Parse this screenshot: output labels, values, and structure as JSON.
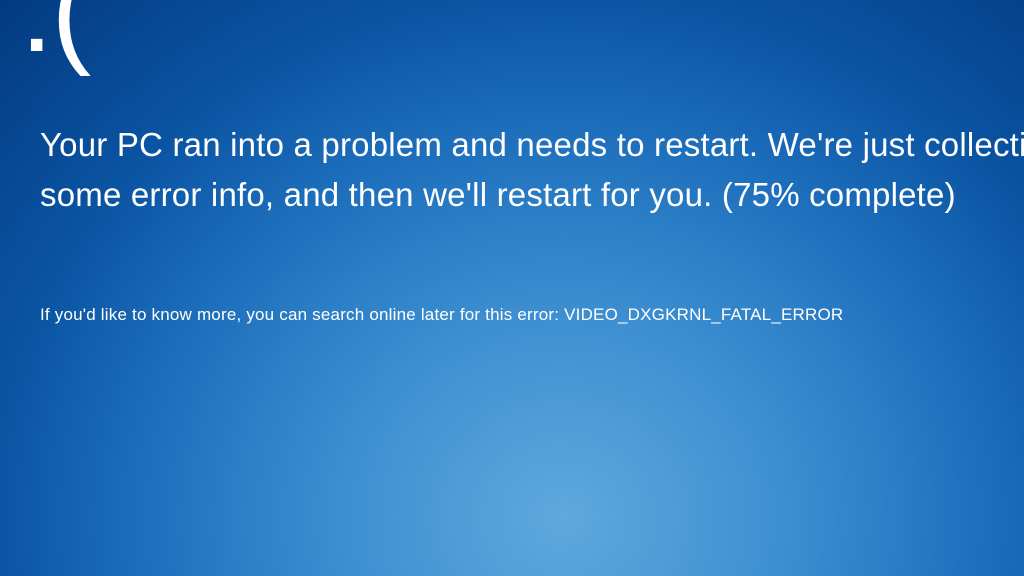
{
  "bsod": {
    "emoticon": ":(",
    "message": "Your PC ran into a problem and needs to restart. We're just collecting some error info, and then we'll restart for you. (75% complete)",
    "details": "If you'd like to know more, you can search online later for this error: VIDEO_DXGKRNL_FATAL_ERROR"
  }
}
